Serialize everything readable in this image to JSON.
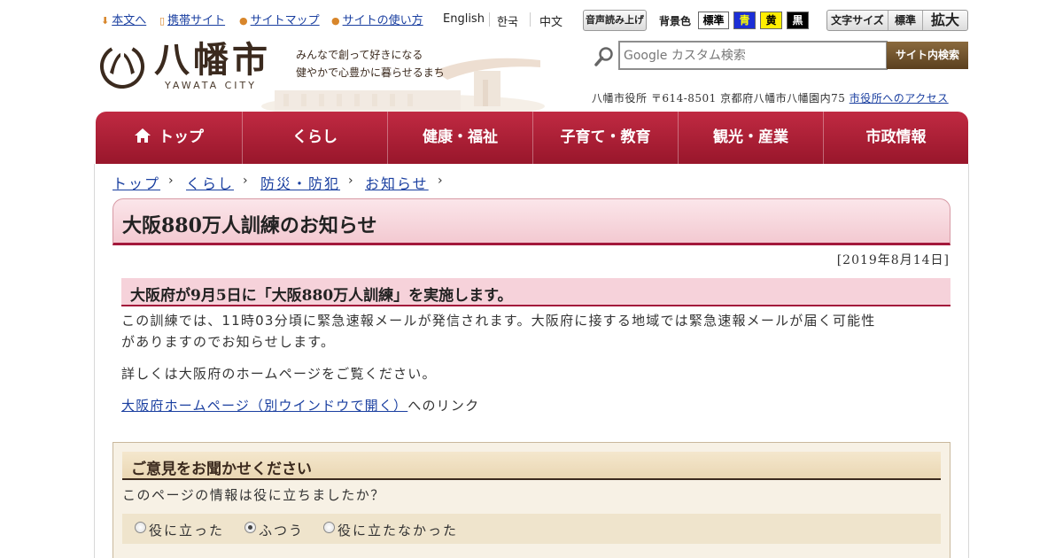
{
  "utility": {
    "skip_link": "本文へ",
    "mobile_link": "携帯サイト",
    "sitemap_link": "サイトマップ",
    "howto_link": "サイトの使い方",
    "languages": [
      "English",
      "한국",
      "中文"
    ],
    "voice_button": "音声読み上げ",
    "bg_label": "背景色",
    "bg_options": [
      {
        "label": "標準",
        "bg": "#ffffff",
        "fg": "#000000"
      },
      {
        "label": "青",
        "bg": "#1c2fd6",
        "fg": "#ffff00"
      },
      {
        "label": "黄",
        "bg": "#ffee00",
        "fg": "#000000"
      },
      {
        "label": "黒",
        "bg": "#000000",
        "fg": "#ffffff"
      }
    ],
    "font_size_label": "文字サイズ",
    "font_standard": "標準",
    "font_large": "拡大"
  },
  "logo": {
    "name": "八幡市",
    "sub": "YAWATA CITY",
    "tagline_1": "みんなで創って好きになる",
    "tagline_2": "健やかで心豊かに暮らせるまち"
  },
  "search": {
    "placeholder": "Google カスタム検索",
    "value": "",
    "button": "サイト内検索"
  },
  "address": {
    "text": "八幡市役所 〒614-8501 京都府八幡市八幡園内75",
    "access_link": "市役所へのアクセス"
  },
  "nav": [
    {
      "label": "トップ",
      "icon": "home-icon"
    },
    {
      "label": "くらし"
    },
    {
      "label": "健康・福祉"
    },
    {
      "label": "子育て・教育"
    },
    {
      "label": "観光・産業"
    },
    {
      "label": "市政情報"
    }
  ],
  "breadcrumb": [
    "トップ",
    "くらし",
    "防災・防犯",
    "お知らせ"
  ],
  "article": {
    "title": "大阪880万人訓練のお知らせ",
    "date": "[2019年8月14日]",
    "heading": "大阪府が9月5日に「大阪880万人訓練」を実施します。",
    "para1_line1": "この訓練では、11時03分頃に緊急速報メールが発信されます。大阪府に接する地域では緊急速報メールが届く可能性",
    "para1_line2": "がありますのでお知らせします。",
    "para2": "詳しくは大阪府のホームページをご覧ください。",
    "link_text": "大阪府ホームページ（別ウインドウで開く）",
    "link_suffix": "へのリンク"
  },
  "feedback": {
    "title": "ご意見をお聞かせください",
    "question": "このページの情報は役に立ちましたか？",
    "options": [
      "役に立った",
      "ふつう",
      "役に立たなかった"
    ],
    "selected": "ふつう"
  },
  "colors": {
    "nav_red": "#b01f38",
    "accent_brown": "#5b401f",
    "link_blue": "#1a3fa0"
  }
}
